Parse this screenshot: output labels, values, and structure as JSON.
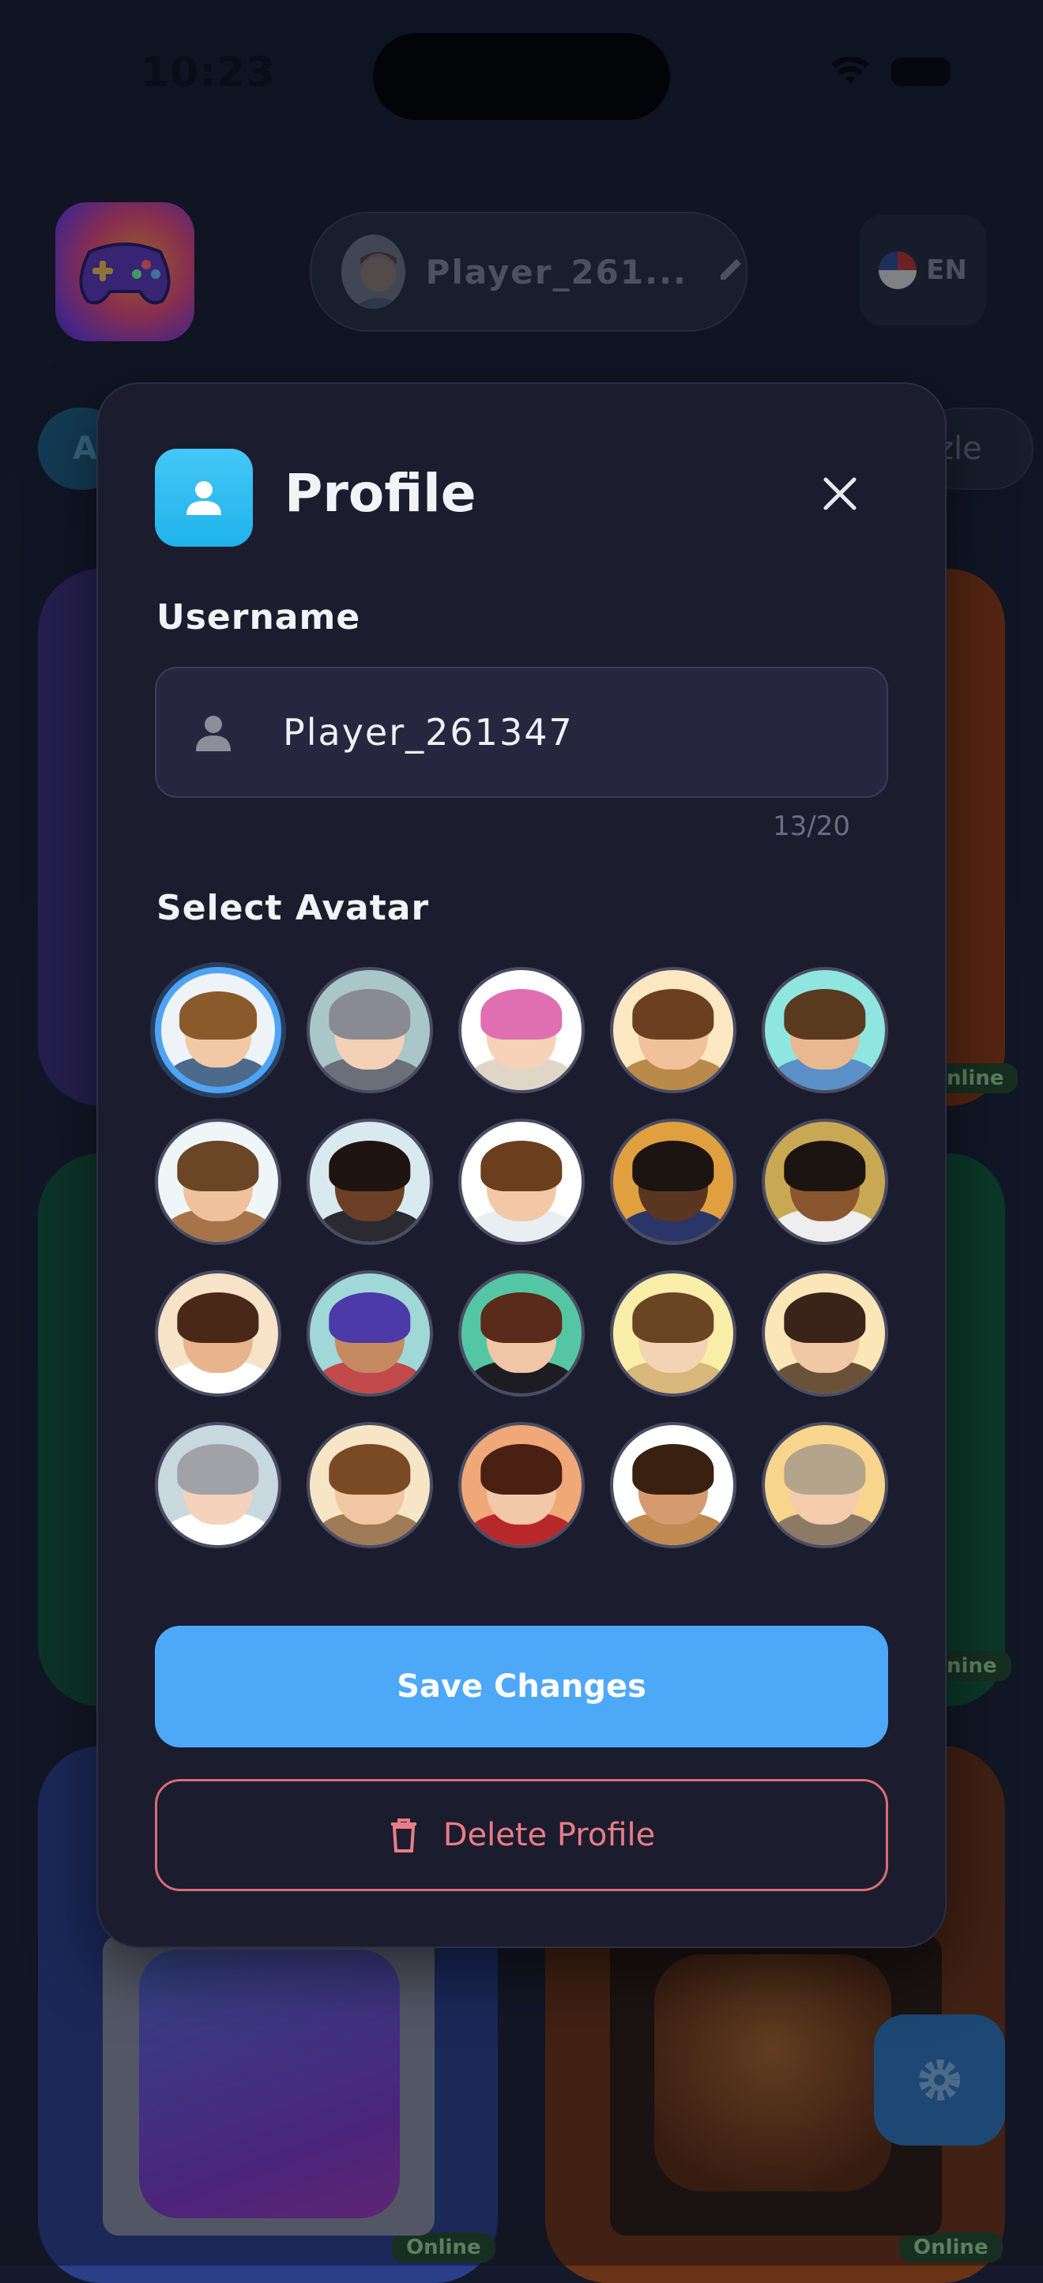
{
  "status_bar": {
    "time": "10:23"
  },
  "header": {
    "player_name": "Player_261...",
    "language": "EN",
    "chip_left": "A",
    "chip_right": "zle"
  },
  "background_cards": {
    "badge_label": "Online",
    "badge_mid_1": "nline",
    "badge_mid_2": "nine"
  },
  "modal": {
    "title": "Profile",
    "username_label": "Username",
    "username_value": "Player_261347",
    "char_counter": "13/20",
    "avatar_label": "Select Avatar",
    "selected_avatar_index": 0,
    "save_label": "Save Changes",
    "delete_label": "Delete Profile"
  },
  "avatars": [
    {
      "name": "avatar-1",
      "skin": "#f1c9a5",
      "hair": "#8a5a2b",
      "body": "#4b6a8c",
      "bg": "#eef3f7"
    },
    {
      "name": "avatar-2",
      "skin": "#f3d0b6",
      "hair": "#8a8a94",
      "body": "#6a6f7a",
      "bg": "#a9c7c9"
    },
    {
      "name": "avatar-3",
      "skin": "#f5d2b8",
      "hair": "#e06fb1",
      "body": "#e0d6c8",
      "bg": "#ffffff"
    },
    {
      "name": "avatar-4",
      "skin": "#f1c19a",
      "hair": "#6a4021",
      "body": "#b98a4a",
      "bg": "#fbe8c2"
    },
    {
      "name": "avatar-5",
      "skin": "#eab890",
      "hair": "#5a3a1f",
      "body": "#5a8fc8",
      "bg": "#8fe6e0"
    },
    {
      "name": "avatar-6",
      "skin": "#efc29c",
      "hair": "#6a4526",
      "body": "#a7744a",
      "bg": "#eef6f8"
    },
    {
      "name": "avatar-7",
      "skin": "#6b4026",
      "hair": "#1f1410",
      "body": "#2a2a30",
      "bg": "#d8eaf0"
    },
    {
      "name": "avatar-8",
      "skin": "#f2c8a6",
      "hair": "#6b3f1e",
      "body": "#e8eef2",
      "bg": "#ffffff"
    },
    {
      "name": "avatar-9",
      "skin": "#5a3620",
      "hair": "#1c1410",
      "body": "#2a3568",
      "bg": "#e0a040"
    },
    {
      "name": "avatar-10",
      "skin": "#8a5630",
      "hair": "#1c1410",
      "body": "#eeeeee",
      "bg": "#c9a854"
    },
    {
      "name": "avatar-11",
      "skin": "#e7b48d",
      "hair": "#4a2818",
      "body": "#ffffff",
      "bg": "#f6e3c8"
    },
    {
      "name": "avatar-12",
      "skin": "#c68a62",
      "hair": "#4b3aa8",
      "body": "#c24a4a",
      "bg": "#9fd8d6"
    },
    {
      "name": "avatar-13",
      "skin": "#f0c7a6",
      "hair": "#5a2a1a",
      "body": "#1c1c22",
      "bg": "#55c6a4"
    },
    {
      "name": "avatar-14",
      "skin": "#f3d3b3",
      "hair": "#6a4524",
      "body": "#d7b77a",
      "bg": "#f9eea8"
    },
    {
      "name": "avatar-15",
      "skin": "#f0c8a4",
      "hair": "#3a241a",
      "body": "#6a5238",
      "bg": "#fbe6b8"
    },
    {
      "name": "avatar-16",
      "skin": "#f4d2bc",
      "hair": "#a0a2a8",
      "body": "#ffffff",
      "bg": "#c7d8df"
    },
    {
      "name": "avatar-17",
      "skin": "#f1c6a2",
      "hair": "#7a4a24",
      "body": "#9e7a56",
      "bg": "#f6e6c6"
    },
    {
      "name": "avatar-18",
      "skin": "#f2c8aa",
      "hair": "#4a2012",
      "body": "#b8282a",
      "bg": "#f0a878"
    },
    {
      "name": "avatar-19",
      "skin": "#d59a70",
      "hair": "#3a2010",
      "body": "#c08a50",
      "bg": "#ffffff"
    },
    {
      "name": "avatar-20",
      "skin": "#f2ccac",
      "hair": "#b4a48c",
      "body": "#8c7a64",
      "bg": "#f8d58c"
    }
  ],
  "colors": {
    "accent": "#4ea8f8",
    "danger": "#e87d85",
    "modal_bg": "#1b1c2e",
    "icon_tile": "#2bbcee"
  },
  "icons": {
    "title_icon": "person-icon",
    "close": "close-icon",
    "input_icon": "person-icon",
    "delete": "trash-icon",
    "edit": "pencil-icon",
    "settings": "gear-icon"
  }
}
